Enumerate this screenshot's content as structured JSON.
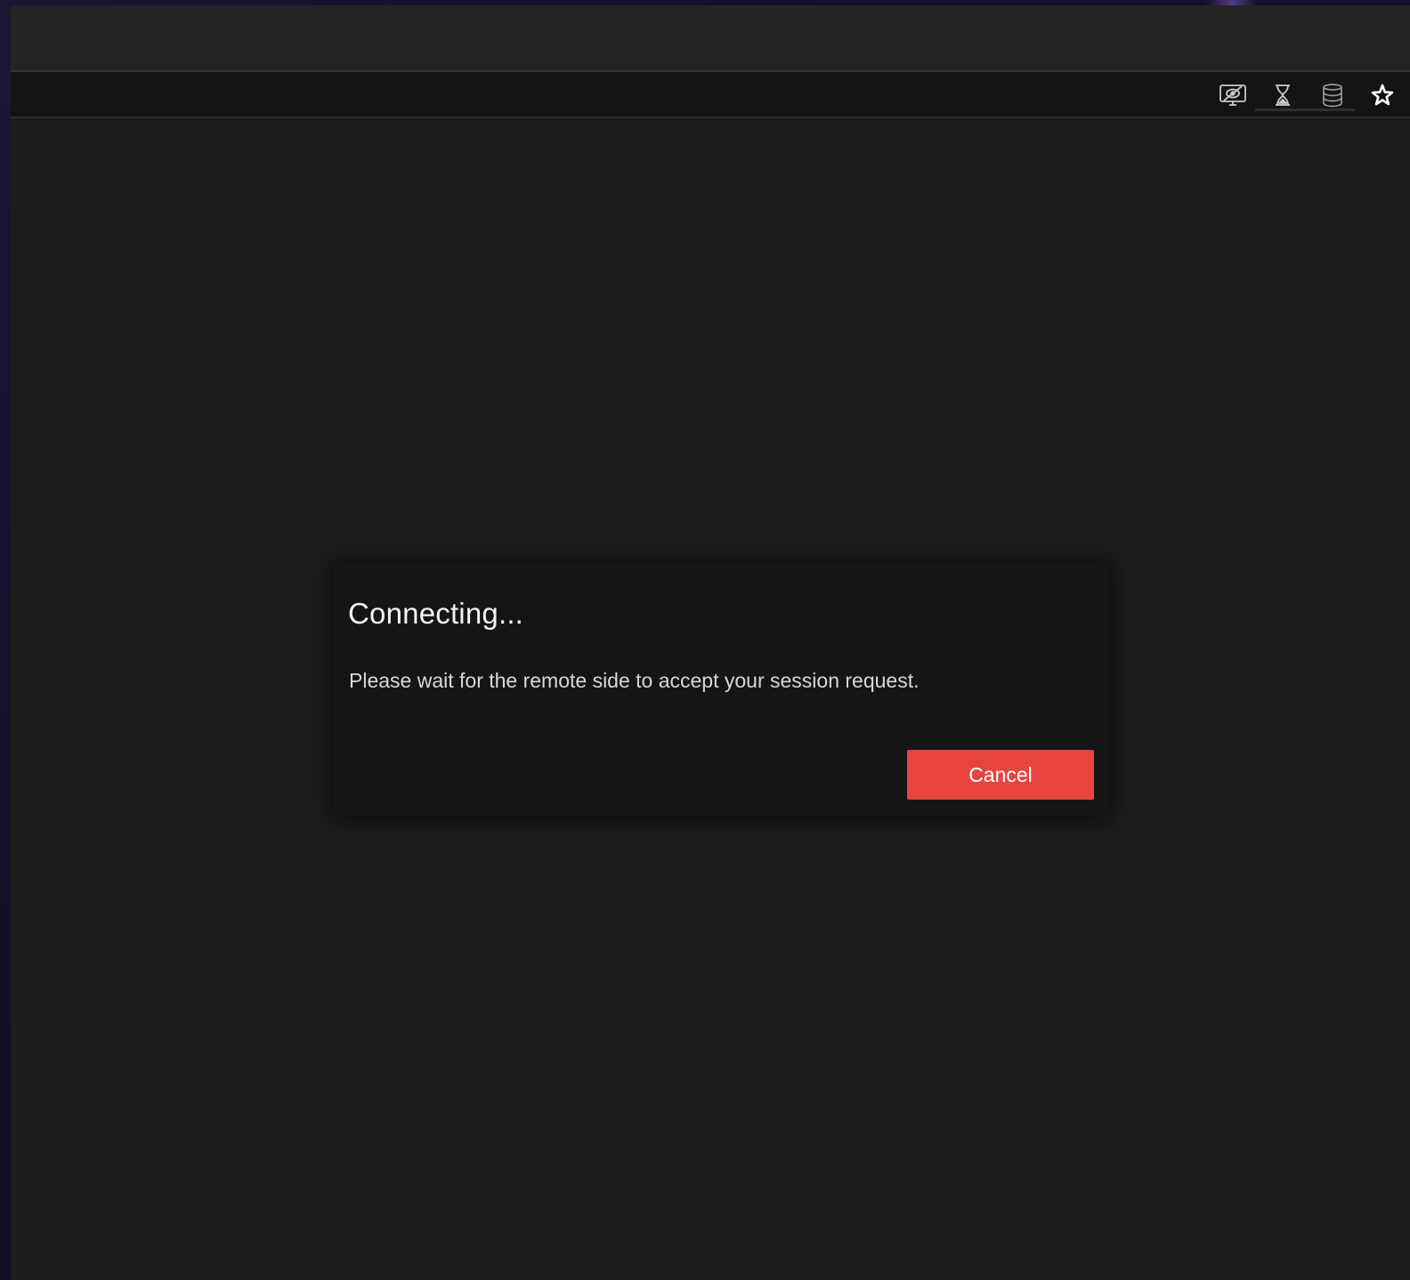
{
  "toolbar": {
    "icons": [
      {
        "name": "hide-screen-icon"
      },
      {
        "name": "hourglass-icon"
      },
      {
        "name": "database-icon"
      },
      {
        "name": "star-icon"
      }
    ]
  },
  "dialog": {
    "title": "Connecting...",
    "message": "Please wait for the remote side to accept your session request.",
    "cancel_label": "Cancel"
  },
  "colors": {
    "window_bg": "#1c1c1d",
    "title_bar_bg": "#242424",
    "toolbar_bg": "#141415",
    "dialog_bg": "#151516",
    "cancel_button": "#e8443e"
  }
}
